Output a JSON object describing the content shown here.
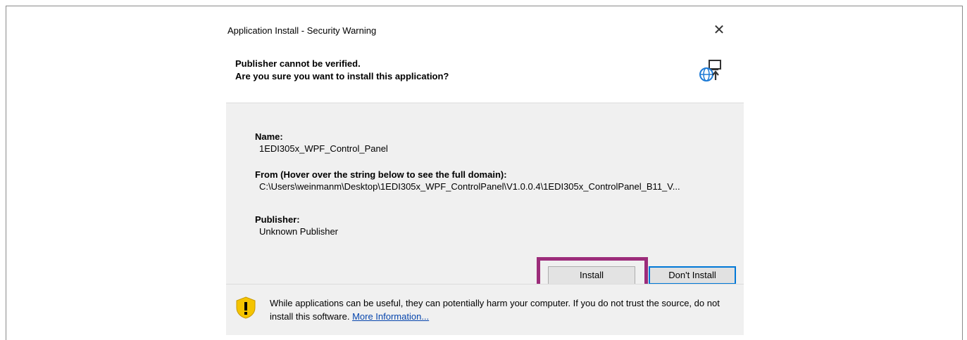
{
  "window": {
    "title": "Application Install - Security Warning",
    "close_glyph": "✕"
  },
  "header": {
    "line1": "Publisher cannot be verified.",
    "line2": "Are you sure you want to install this application?",
    "icon": "globe-install-icon"
  },
  "details": {
    "name_label": "Name:",
    "name_value": "1EDI305x_WPF_Control_Panel",
    "from_label": "From (Hover over the string below to see the full domain):",
    "from_value": "C:\\Users\\weinmanm\\Desktop\\1EDI305x_WPF_ControlPanel\\V1.0.0.4\\1EDI305x_ControlPanel_B11_V...",
    "publisher_label": "Publisher:",
    "publisher_value": "Unknown Publisher"
  },
  "buttons": {
    "install_label": "Install",
    "dont_install_label": "Don't Install"
  },
  "footer": {
    "icon": "warning-shield-icon",
    "warning_text": "While applications can be useful, they can potentially harm your computer. If you do not trust the source, do not install this software.",
    "more_info_link": "More Information..."
  },
  "colors": {
    "highlight_border": "#9c2c7a",
    "focus_border": "#0078d7",
    "link": "#0645ad",
    "panel_bg": "#f0f0f0"
  }
}
